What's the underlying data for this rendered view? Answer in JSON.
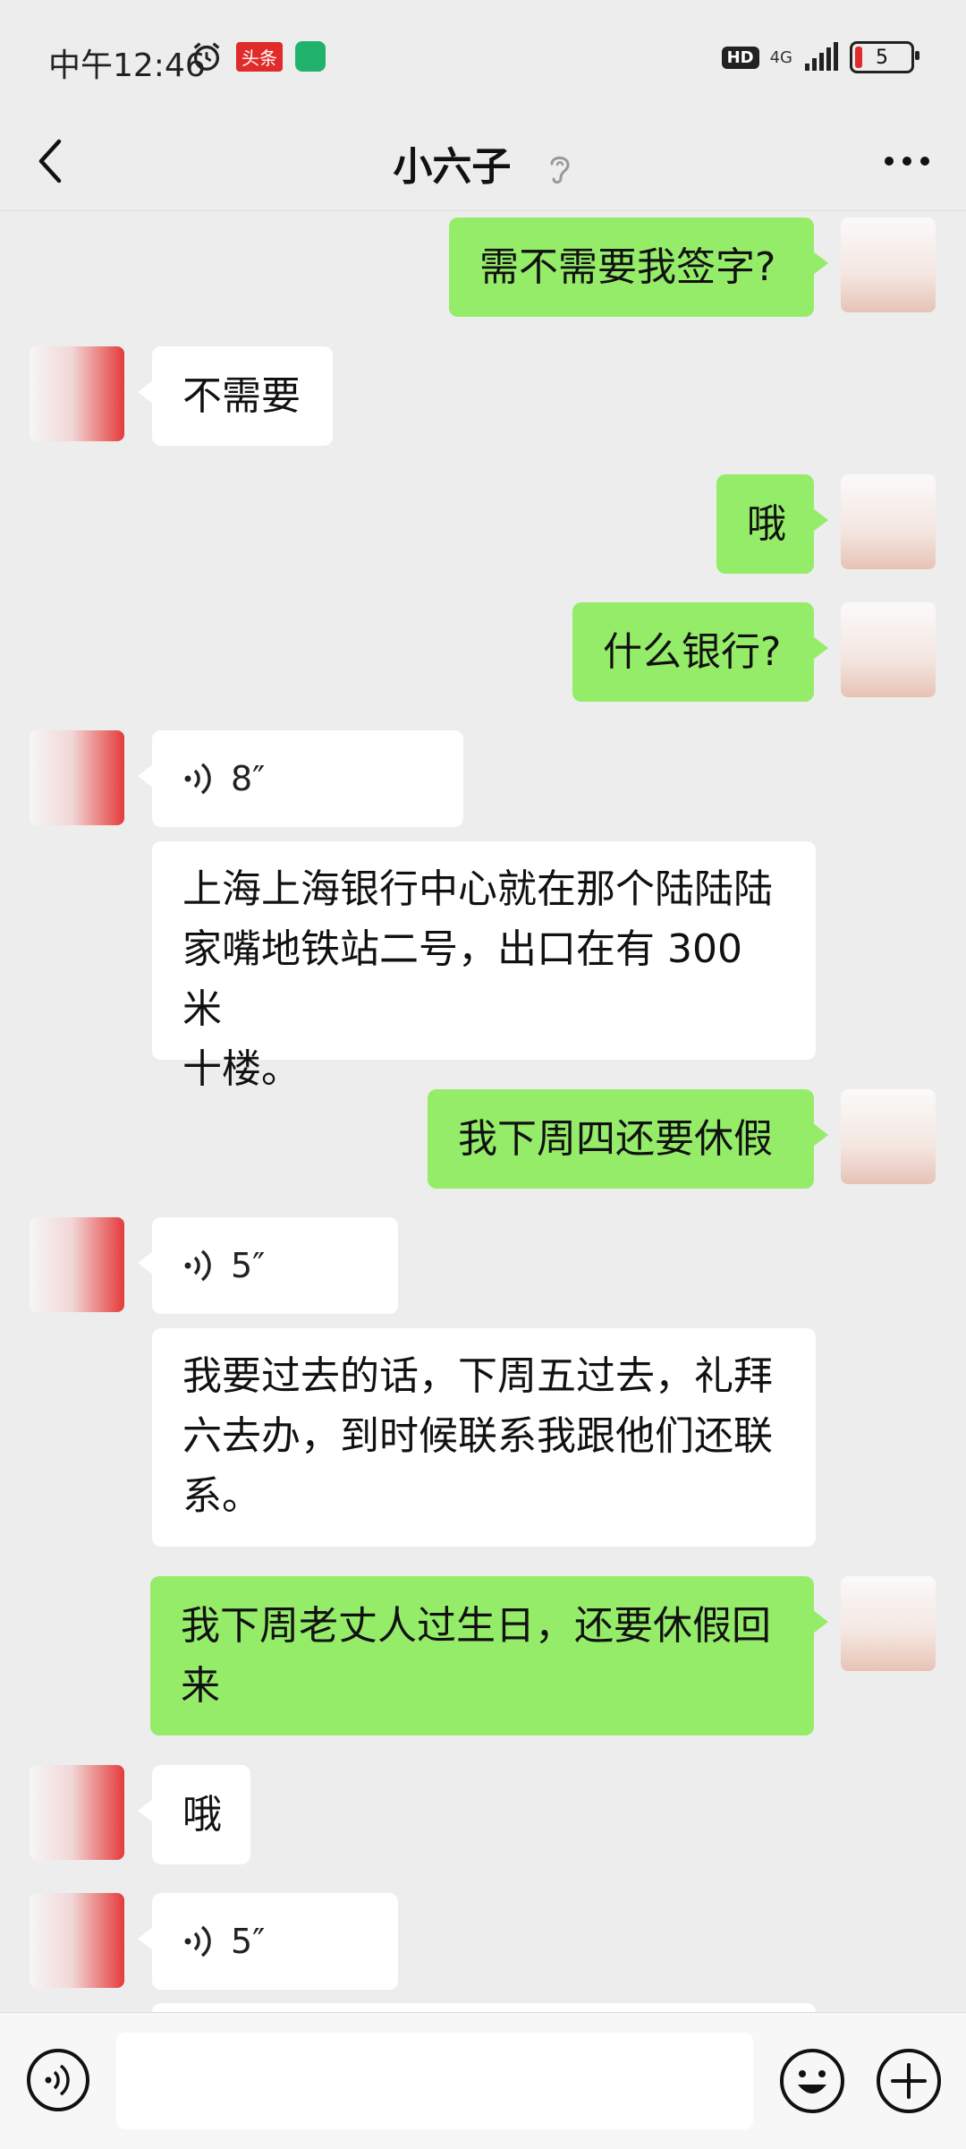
{
  "status_bar": {
    "time": "中午12:46",
    "news_badge": "头条",
    "hd": "HD",
    "network": "4G",
    "battery": "5"
  },
  "header": {
    "title": "小六子"
  },
  "messages": [
    {
      "sender": "self",
      "text": "需不需要我签字?"
    },
    {
      "sender": "other",
      "text": "不需要"
    },
    {
      "sender": "self",
      "text": "哦"
    },
    {
      "sender": "self",
      "text": "什么银行?"
    },
    {
      "sender": "other",
      "type": "voice",
      "duration": "8″"
    },
    {
      "sender": "other",
      "text_lines": [
        "上海上海银行中心就在那个陆陆陆",
        "家嘴地铁站二号，出口在有 300 米",
        "十楼。"
      ]
    },
    {
      "sender": "self",
      "text": "我下周四还要休假"
    },
    {
      "sender": "other",
      "type": "voice",
      "duration": "5″"
    },
    {
      "sender": "other",
      "text_lines": [
        "我要过去的话，下周五过去，礼拜",
        "六去办，到时候联系我跟他们还联",
        "系。"
      ]
    },
    {
      "sender": "self",
      "text_lines": [
        "我下周老丈人过生日，还要休假回",
        "来"
      ]
    },
    {
      "sender": "other",
      "text": "哦"
    },
    {
      "sender": "other",
      "type": "voice",
      "duration": "5″"
    }
  ],
  "input_bar": {
    "placeholder": ""
  },
  "colors": {
    "background": "#ededed",
    "self_bubble": "#95ec69",
    "other_bubble": "#ffffff"
  },
  "icons": [
    "back-arrow-icon",
    "ear-icon",
    "more-icon",
    "voice-icon",
    "emoji-icon",
    "plus-icon"
  ]
}
